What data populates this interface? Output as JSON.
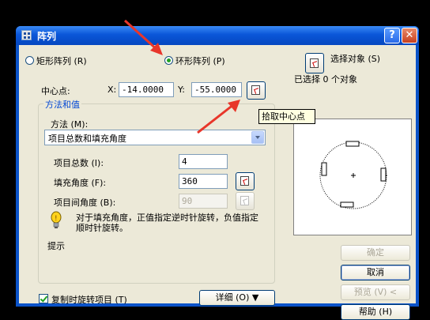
{
  "window": {
    "title": "阵列",
    "help_glyph": "?",
    "close_glyph": "✕"
  },
  "array_type": {
    "rect_label": "矩形阵列 (R)",
    "polar_label": "环形阵列 (P)",
    "selected": "polar"
  },
  "center_point": {
    "label": "中心点:",
    "x_label": "X:",
    "x_value": "-14.0000",
    "y_label": "Y:",
    "y_value": "-55.0000",
    "pick_tooltip": "拾取中心点"
  },
  "method_group": {
    "title": "方法和值",
    "method_label": "方法 (M):",
    "method_value": "项目总数和填充角度",
    "total_label": "项目总数 (I):",
    "total_value": "4",
    "fill_label": "填充角度 (F):",
    "fill_value": "360",
    "between_label": "项目间角度 (B):",
    "between_value": "90",
    "note": "对于填充角度，正值指定逆时针旋转，负值指定顺时针旋转。",
    "tip_label": "提示"
  },
  "rotate_items": {
    "label": "复制时旋转项目 (T)",
    "checked": true
  },
  "details_button": "详细 (O) ▼",
  "select_objects": {
    "label": "选择对象 (S)",
    "status": "已选择 0 个对象"
  },
  "buttons": {
    "ok": "确定",
    "cancel": "取消",
    "preview": "预览 (V) <",
    "help": "帮助 (H)"
  },
  "colors": {
    "titlebar": "#0a56d8",
    "dialog_bg": "#ece9d8",
    "annotation_arrow": "#e8362a",
    "group_title": "#0046d5"
  }
}
